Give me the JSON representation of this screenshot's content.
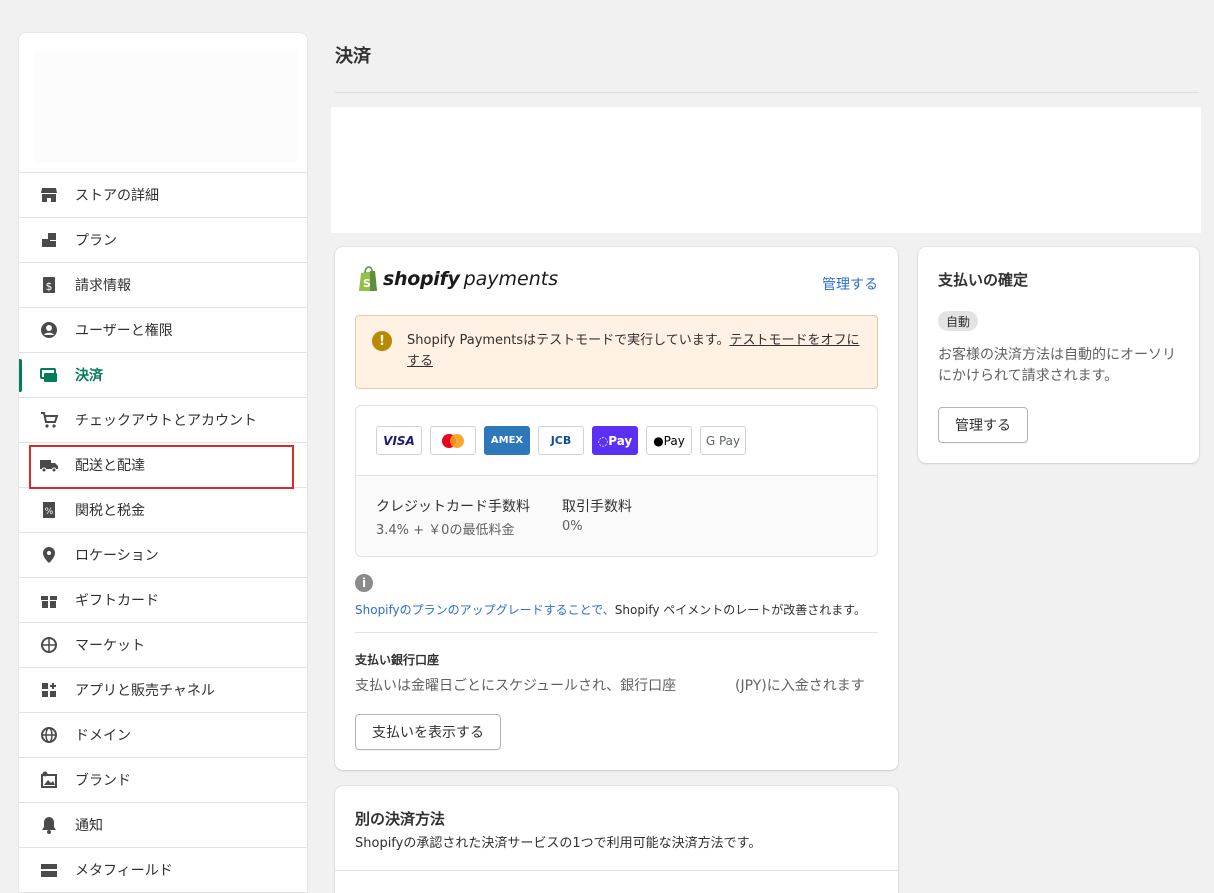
{
  "sidebar": {
    "items": [
      {
        "label": "ストアの詳細",
        "icon": "store-icon"
      },
      {
        "label": "プラン",
        "icon": "plan-icon"
      },
      {
        "label": "請求情報",
        "icon": "billing-icon"
      },
      {
        "label": "ユーザーと権限",
        "icon": "user-icon"
      },
      {
        "label": "決済",
        "icon": "payments-icon"
      },
      {
        "label": "チェックアウトとアカウント",
        "icon": "cart-icon"
      },
      {
        "label": "配送と配達",
        "icon": "truck-icon"
      },
      {
        "label": "関税と税金",
        "icon": "tax-icon"
      },
      {
        "label": "ロケーション",
        "icon": "location-icon"
      },
      {
        "label": "ギフトカード",
        "icon": "gift-icon"
      },
      {
        "label": "マーケット",
        "icon": "globe-icon"
      },
      {
        "label": "アプリと販売チャネル",
        "icon": "apps-icon"
      },
      {
        "label": "ドメイン",
        "icon": "domain-icon"
      },
      {
        "label": "ブランド",
        "icon": "brand-icon"
      },
      {
        "label": "通知",
        "icon": "bell-icon"
      },
      {
        "label": "メタフィールド",
        "icon": "metafield-icon"
      }
    ],
    "active_item": "決済",
    "highlighted_item": "配送と配達"
  },
  "page": {
    "title": "決済"
  },
  "payments_card": {
    "brand_bold": "shopify",
    "brand_light": "payments",
    "manage_link": "管理する",
    "banner_text": "Shopify Paymentsはテストモードで実行しています。",
    "banner_link": "テストモードをオフにする",
    "methods": [
      "VISA",
      "Mastercard",
      "AMEX",
      "JCB",
      "Shop Pay",
      "Apple Pay",
      "Google Pay"
    ],
    "credit_fee_label": "クレジットカード手数料",
    "credit_fee_value": "3.4% + ￥0の最低料金",
    "transaction_fee_label": "取引手数料",
    "transaction_fee_value": "0%",
    "upgrade_link": "Shopifyのプランのアップグレードすることで、",
    "upgrade_text": "Shopify ペイメントのレートが改善されます。",
    "bank_title": "支払い銀行口座",
    "bank_desc": "支払いは金曜日ごとにスケジュールされ、銀行口座",
    "bank_desc_currency": "(JPY)に入金されます",
    "payouts_button": "支払いを表示する"
  },
  "confirm_card": {
    "title": "支払いの確定",
    "badge": "自動",
    "desc": "お客様の決済方法は自動的にオーソリにかけられて請求されます。",
    "manage_button": "管理する"
  },
  "other_card": {
    "title": "別の決済方法",
    "desc": "Shopifyの承認された決済サービスの1つで利用可能な決済方法です。"
  },
  "colors": {
    "accent": "#047b5d",
    "link": "#2c6ecb",
    "highlight_border": "#d72c2c",
    "banner_bg": "#fff1e3"
  }
}
